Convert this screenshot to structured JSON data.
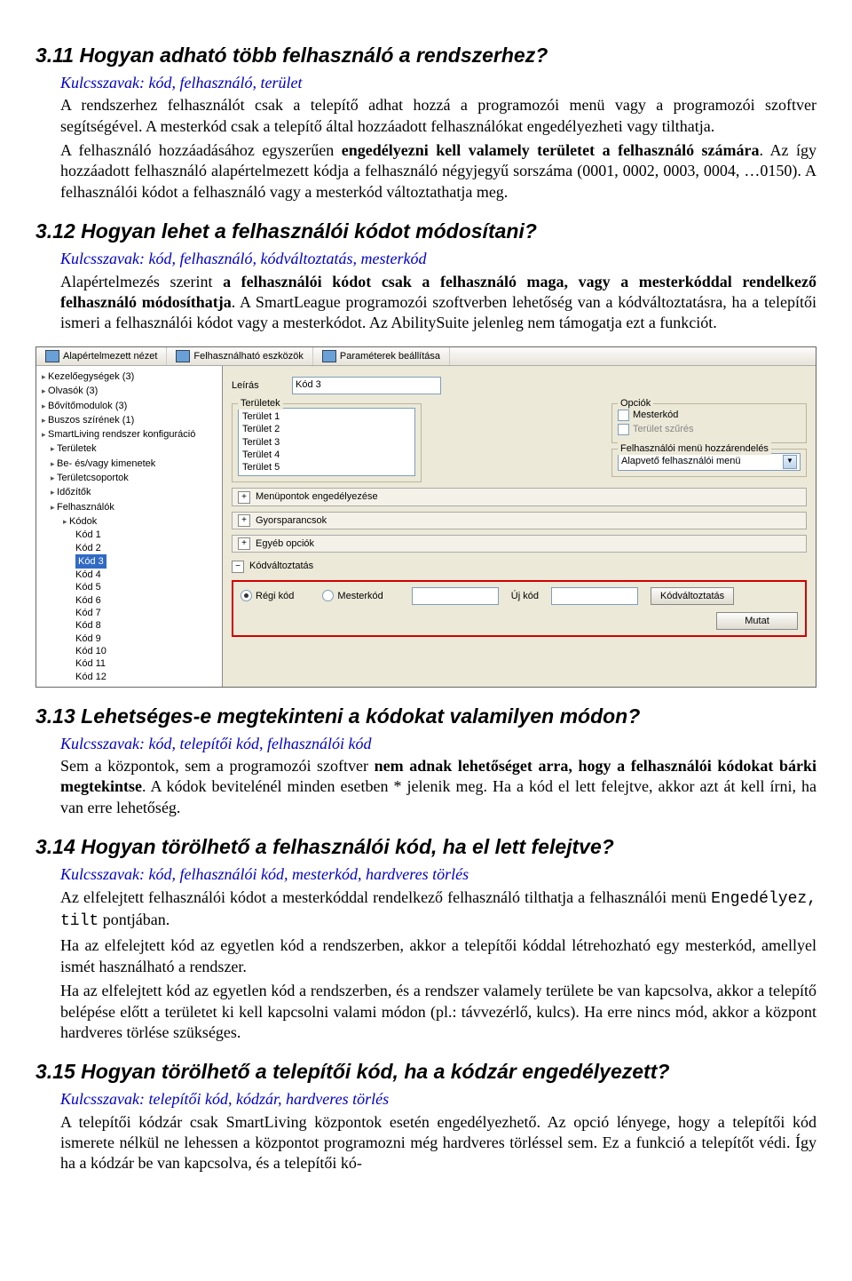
{
  "s311": {
    "heading": "3.11 Hogyan adható több felhasználó a rendszerhez?",
    "kulcs": "Kulcsszavak: kód, felhasználó, terület",
    "p1a": "A rendszerhez felhasználót csak a telepítő adhat hozzá a programozói menü vagy a programozói szoftver segítségével. A mesterkód csak a telepítő által hozzáadott felhasználókat engedélyezheti vagy tilthatja.",
    "p1b_pre": "A felhasználó hozzáadásához egyszerűen ",
    "p1b_bold": "engedélyezni kell valamely területet a felhasználó számára",
    "p1b_post": ". Az így hozzáadott felhasználó alapértelmezett kódja a felhasználó négyjegyű sorszáma (0001, 0002, 0003, 0004, …0150). A felhasználói kódot a felhasználó vagy a mesterkód változtathatja meg."
  },
  "s312": {
    "heading": "3.12 Hogyan lehet a felhasználói kódot módosítani?",
    "kulcs": "Kulcsszavak: kód, felhasználó, kódváltoztatás, mesterkód",
    "p_pre": "Alapértelmezés szerint ",
    "p_bold": "a felhasználói kódot csak a felhasználó maga, vagy a mesterkóddal rendelkező felhasználó módosíthatja",
    "p_post": ". A SmartLeague programozói szoftverben lehetőség van a kódváltoztatásra, ha a telepítői ismeri a felhasználói kódot vagy a mesterkódot. Az AbilitySuite jelenleg nem támogatja ezt a funkciót."
  },
  "app": {
    "toolbar": {
      "view": "Alapértelmezett nézet",
      "tools": "Felhasználható eszközök",
      "params": "Paraméterek beállítása"
    },
    "tree": {
      "kezelo": "Kezelőegységek (3)",
      "olvasok": "Olvasók (3)",
      "bovito": "Bővítőmodulok (3)",
      "buszos": "Buszos szírének (1)",
      "smartliving": "SmartLiving rendszer konfiguráció",
      "teruletek": "Területek",
      "be_es": "Be- és/vagy kimenetek",
      "teruletcsoportok": "Területcsoportok",
      "idozitok": "Időzítők",
      "felhasznalok": "Felhasználók",
      "kodok": "Kódok",
      "kod": [
        "Kód 1",
        "Kód 2",
        "Kód 3",
        "Kód 4",
        "Kód 5",
        "Kód 6",
        "Kód 7",
        "Kód 8",
        "Kód 9",
        "Kód 10",
        "Kód 11",
        "Kód 12"
      ]
    },
    "leiras_lbl": "Leírás",
    "leiras_val": "Kód 3",
    "teruletek_lbl": "Területek",
    "teruletek": [
      "Terület 1",
      "Terület 2",
      "Terület 3",
      "Terület 4",
      "Terület 5"
    ],
    "opciok_lbl": "Opciók",
    "opciok": [
      "Mesterkód",
      "Terület szűrés"
    ],
    "menu_lbl": "Felhasználói menü hozzárendelés",
    "menu_sel": "Alapvető felhasználói menü",
    "expanders": [
      "Menüpontok engedélyezése",
      "Gyorsparancsok",
      "Egyéb opciók"
    ],
    "kodvalt_lbl": "Kódváltoztatás",
    "regi": "Régi kód",
    "mester": "Mesterkód",
    "uj": "Új kód",
    "btn_change": "Kódváltoztatás",
    "btn_show": "Mutat"
  },
  "s313": {
    "heading": "3.13 Lehetséges-e megtekinteni a kódokat valamilyen módon?",
    "kulcs": "Kulcsszavak: kód, telepítői kód, felhasználói kód",
    "p_pre": "Sem a központok, sem a programozói szoftver ",
    "p_bold": "nem adnak lehetőséget arra, hogy a felhasználói kódokat bárki megtekintse",
    "p_post": ". A kódok bevitelénél minden esetben * jelenik meg. Ha a kód el lett felejtve, akkor azt át kell írni, ha van erre lehetőség."
  },
  "s314": {
    "heading": "3.14 Hogyan törölhető a felhasználói kód, ha el lett felejtve?",
    "kulcs": "Kulcsszavak: kód, felhasználói kód, mesterkód, hardveres törlés",
    "p1_pre": "Az elfelejtett felhasználói kódot a mesterkóddal rendelkező felhasználó tilthatja a felhasználói menü ",
    "p1_mono": "Engedélyez, tilt",
    "p1_post": " pontjában.",
    "p2": "Ha az elfelejtett kód az egyetlen kód a rendszerben, akkor a telepítői kóddal létrehozható egy mesterkód, amellyel ismét használható a rendszer.",
    "p3": "Ha az elfelejtett kód az egyetlen kód a rendszerben, és a rendszer valamely területe be van kapcsolva, akkor a telepítő belépése előtt a területet ki kell kapcsolni valami módon (pl.: távvezérlő, kulcs). Ha erre nincs mód, akkor a központ hardveres törlése szükséges."
  },
  "s315": {
    "heading": "3.15 Hogyan törölhető a telepítői kód, ha a kódzár engedélyezett?",
    "kulcs": "Kulcsszavak: telepítői kód, kódzár, hardveres törlés",
    "p": "A telepítői kódzár csak SmartLiving központok esetén engedélyezhető. Az opció lényege, hogy a telepítői kód ismerete nélkül ne lehessen a központot programozni még hardveres törléssel sem. Ez a funkció a telepítőt védi. Így ha a kódzár be van kapcsolva, és a telepítői kó-"
  }
}
